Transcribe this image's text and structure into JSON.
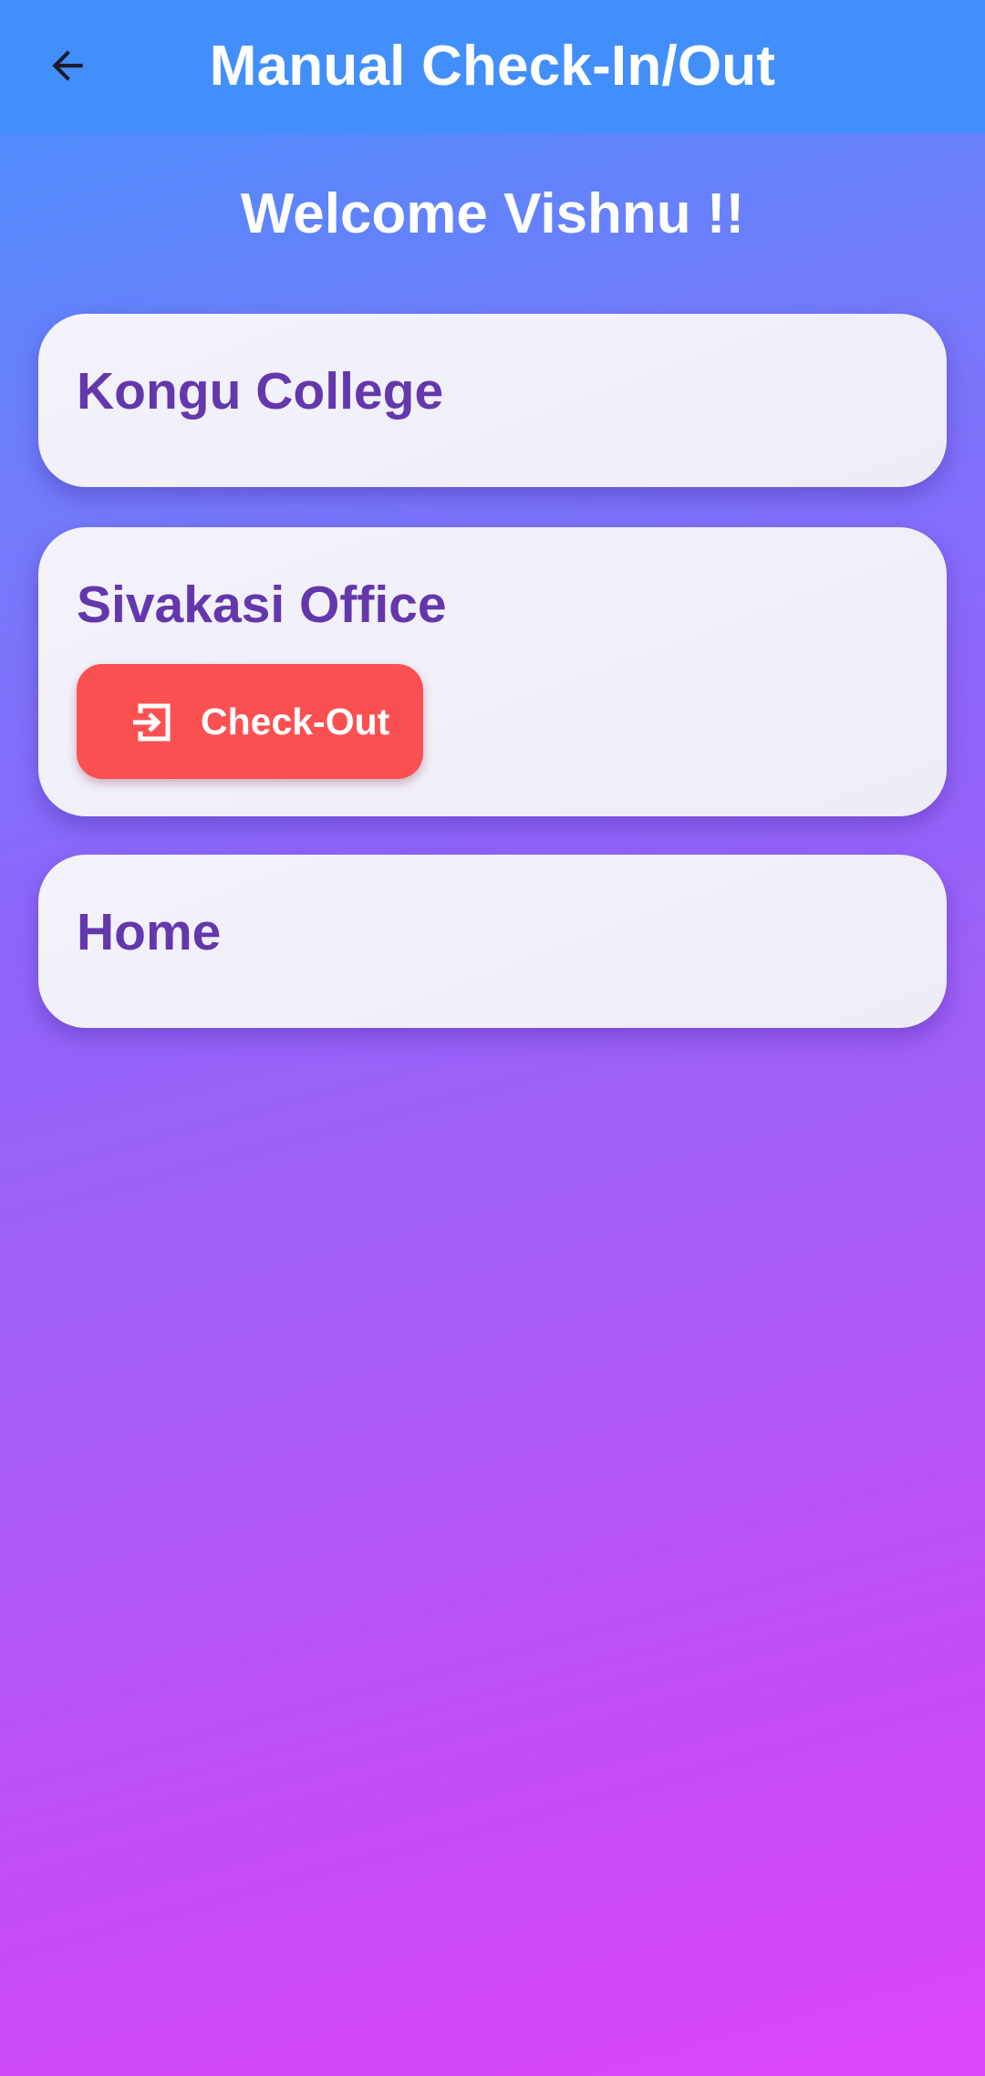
{
  "app_bar": {
    "title": "Manual Check-In/Out",
    "back_icon": "arrow-left-icon",
    "background_color": "#428ffb"
  },
  "welcome_text": "Welcome Vishnu !!",
  "locations": [
    {
      "name": "Kongu College"
    },
    {
      "name": "Sivakasi Office",
      "action_label": "Check-Out",
      "action_icon": "exit-icon",
      "action_color": "#fb5052"
    },
    {
      "name": "Home"
    }
  ],
  "colors": {
    "title_text": "#6437ad",
    "card_background": "#f1eff9",
    "gradient_top": "#4390fc",
    "gradient_bottom": "#dc44fa"
  }
}
